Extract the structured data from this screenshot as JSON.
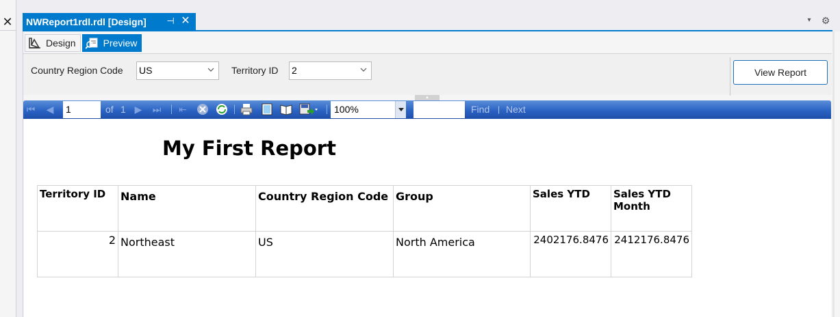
{
  "left_panel": {
    "close_glyph": "✕"
  },
  "document_tab": {
    "title": "NWReport1rdl.rdl [Design]",
    "pin_glyph": "⊣",
    "close_glyph": "✕"
  },
  "window_controls": {
    "dropdown_glyph": "▾",
    "settings_glyph": "⚙"
  },
  "view_tabs": [
    {
      "label": "Design",
      "icon": "design-icon",
      "active": false
    },
    {
      "label": "Preview",
      "icon": "preview-icon",
      "active": true
    }
  ],
  "parameters": {
    "country": {
      "label": "Country Region Code",
      "value": "US"
    },
    "territory": {
      "label": "Territory ID",
      "value": "2"
    },
    "view_report_label": "View Report"
  },
  "toolbar": {
    "page_number": "1",
    "of_label": "of",
    "total_pages": "1",
    "zoom": "100%",
    "find_label": "Find",
    "separator": "|",
    "next_label": "Next"
  },
  "report": {
    "title": "My First Report",
    "columns": [
      "Territory ID",
      "Name",
      "Country Region Code",
      "Group",
      "Sales YTD",
      "Sales YTD Month"
    ],
    "rows": [
      [
        "2",
        "Northeast",
        "US",
        "North America",
        "2402176.8476",
        "2412176.8476"
      ]
    ]
  },
  "colors": {
    "accent": "#007acc",
    "toolbar_top": "#5a8ed8",
    "toolbar_bottom": "#1d4ea8",
    "territory_value": "#1a7a1a"
  }
}
